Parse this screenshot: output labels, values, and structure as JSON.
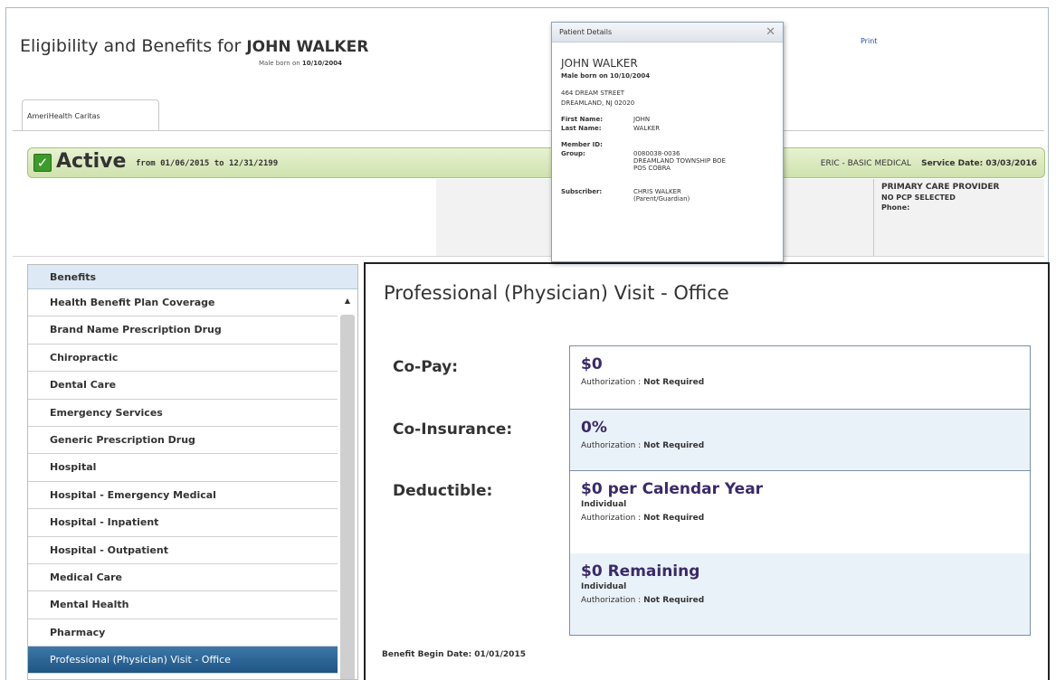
{
  "header": {
    "title_prefix": "Eligibility and Benefits for",
    "patient_name": "JOHN WALKER",
    "subtitle_prefix": "Male born on",
    "subtitle_dob": "10/10/2004",
    "print_label": "Print"
  },
  "tabs": [
    {
      "label": "AmeriHealth Caritas"
    }
  ],
  "status": {
    "label": "Active",
    "range": "from 01/06/2015 to 12/31/2199",
    "plan": "ERIC - BASIC MEDICAL",
    "service_date": "Service Date: 03/03/2016"
  },
  "pcp": {
    "title": "PRIMARY CARE PROVIDER",
    "line1": "NO PCP SELECTED",
    "line2": "Phone:"
  },
  "popup": {
    "title": "Patient Details",
    "name": "JOHN WALKER",
    "sex_dob_prefix": "Male born on",
    "dob": "10/10/2004",
    "address1": "464 DREAM STREET",
    "address2": "DREAMLAND, NJ 02020",
    "first_name_label": "First Name:",
    "first_name": "JOHN",
    "last_name_label": "Last Name:",
    "last_name": "WALKER",
    "member_id_label": "Member ID:",
    "member_id": "",
    "group_label": "Group:",
    "group1": "0080038-0036",
    "group2": "DREAMLAND TOWNSHIP BOE",
    "group3": "POS COBRA",
    "subscriber_label": "Subscriber:",
    "subscriber1": "CHRIS WALKER",
    "subscriber2": "(Parent/Guardian)"
  },
  "benefits": {
    "header": "Benefits",
    "items": [
      "Health Benefit Plan Coverage",
      "Brand Name Prescription Drug",
      "Chiropractic",
      "Dental Care",
      "Emergency Services",
      "Generic Prescription Drug",
      "Hospital",
      "Hospital - Emergency Medical",
      "Hospital - Inpatient",
      "Hospital - Outpatient",
      "Medical Care",
      "Mental Health",
      "Pharmacy",
      "Professional (Physician) Visit - Office"
    ]
  },
  "detail": {
    "title": "Professional (Physician) Visit - Office",
    "copay_label": "Co-Pay:",
    "coins_label": "Co-Insurance:",
    "deduct_label": "Deductible:",
    "copay_value": "$0",
    "coins_value": "0%",
    "deduct_value": "$0 per Calendar Year",
    "deduct_sub": "Individual",
    "remaining_value": "$0 Remaining",
    "remaining_sub": "Individual",
    "auth_prefix": "Authorization :",
    "auth_value": "Not Required",
    "begin_date": "Benefit Begin Date: 01/01/2015"
  }
}
